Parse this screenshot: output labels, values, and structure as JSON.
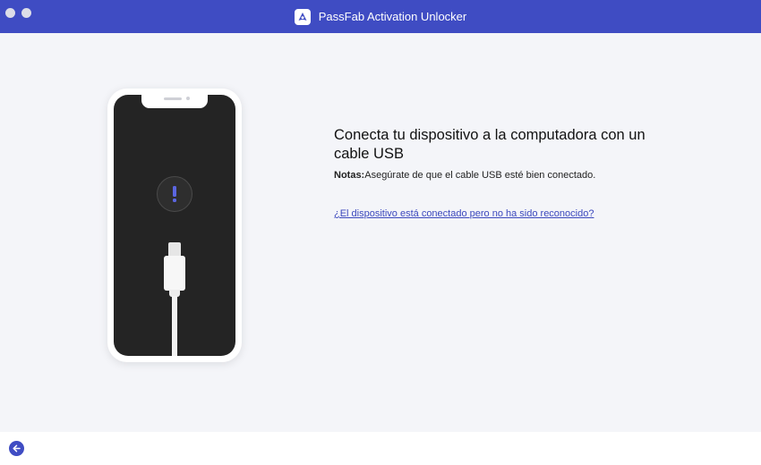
{
  "window": {
    "title": "PassFab Activation Unlocker",
    "logo_icon": "passfab-logo-icon",
    "accent_color": "#3f4cc3"
  },
  "main": {
    "heading": "Conecta tu dispositivo a la computadora con un cable USB",
    "note_label": "Notas:",
    "note_text": "Asegúrate de que el cable USB esté bien conectado.",
    "help_link": "¿El dispositivo está conectado pero no ha sido reconocido?",
    "illustration": {
      "device": "phone-illustration",
      "status_icon": "exclamation-icon",
      "cable": "usb-cable-icon"
    }
  },
  "footer": {
    "back_icon": "arrow-left-icon"
  }
}
